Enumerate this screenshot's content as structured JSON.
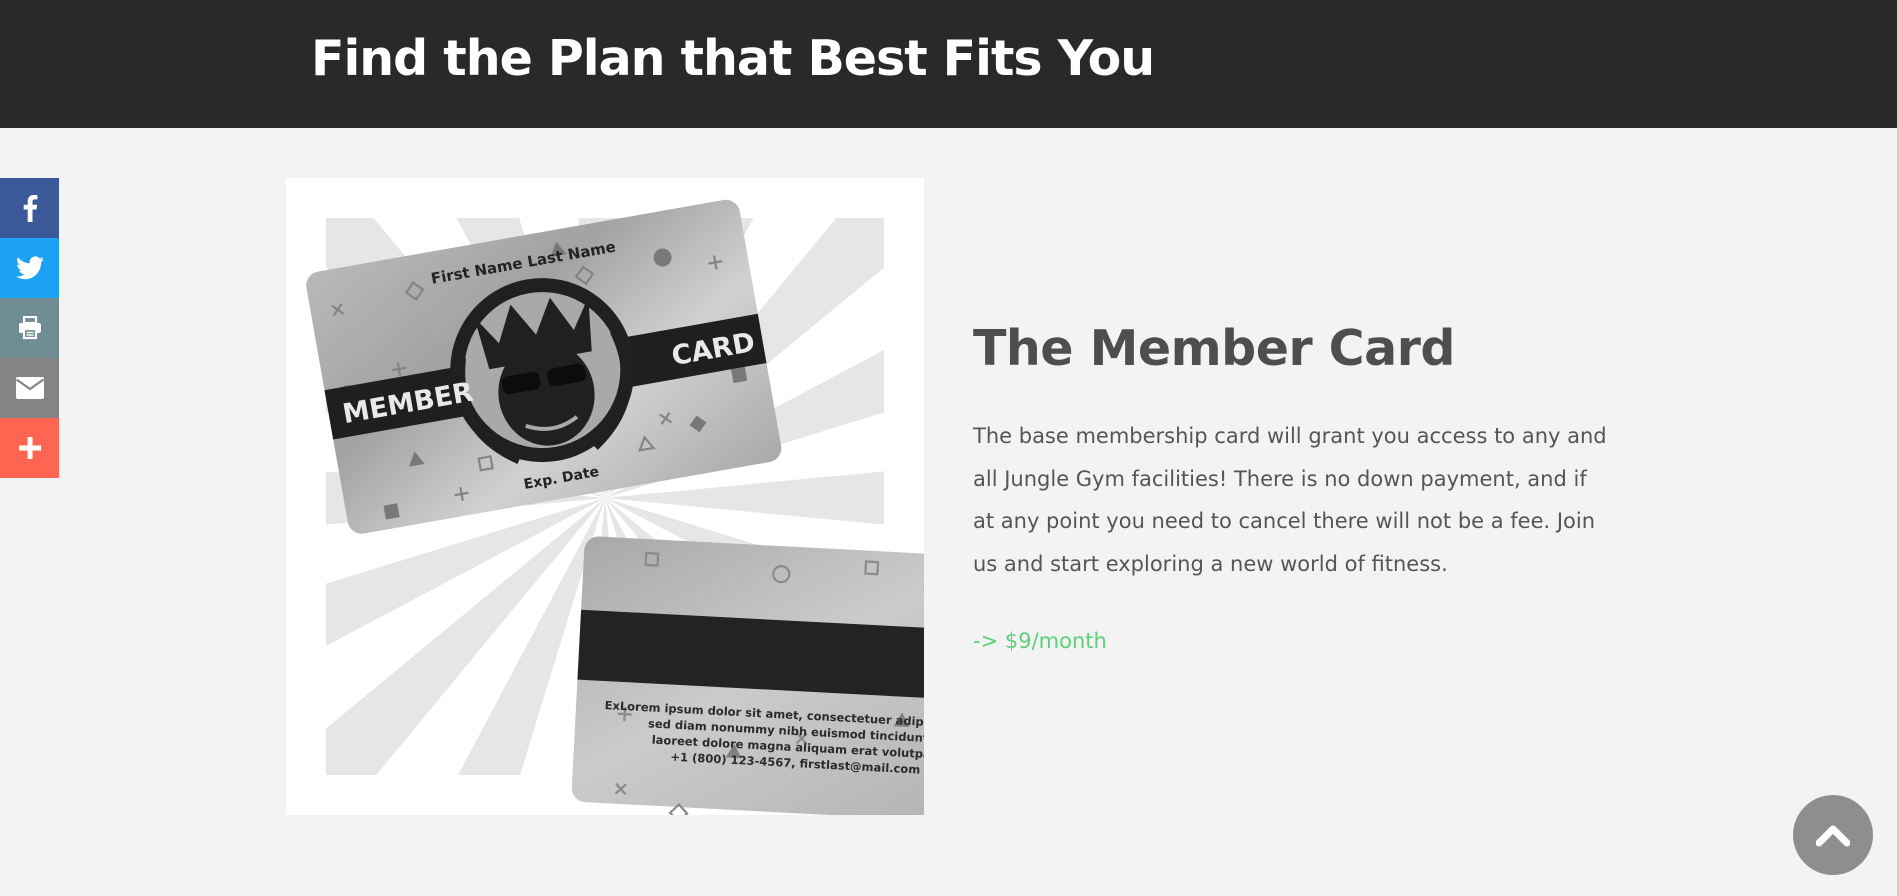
{
  "header": {
    "title": "Find the Plan that Best Fits You"
  },
  "share_bar": {
    "items": [
      {
        "name": "facebook",
        "icon": "facebook-icon",
        "color": "#3b5998"
      },
      {
        "name": "twitter",
        "icon": "twitter-icon",
        "color": "#1da1f2"
      },
      {
        "name": "print",
        "icon": "print-icon",
        "color": "#6f8d93"
      },
      {
        "name": "email",
        "icon": "email-icon",
        "color": "#848484"
      },
      {
        "name": "more",
        "icon": "plus-icon",
        "color": "#ff6550"
      }
    ]
  },
  "card_image": {
    "front_name": "First Name Last Name",
    "front_left": "MEMBER",
    "front_right": "CARD",
    "front_expiry": "Exp. Date",
    "back_lines": [
      "ExLorem ipsum dolor sit amet, consectetuer adipiscing elit,",
      "sed diam nonummy nibh euismod tincidunt ut",
      "laoreet dolore magna aliquam erat volutpat.",
      "+1 (800) 123-4567, firstlast@mail.com"
    ]
  },
  "plan": {
    "title": "The Member Card",
    "description": "The base membership card will grant you access to any and all Jungle Gym facilities! There is no down payment, and if at any point you need to cancel there will not be a fee. Join us and start exploring a new world of fitness.",
    "price": "-> $9/month",
    "price_color": "#5bd17a"
  },
  "back_to_top": {
    "icon": "chevron-up-icon"
  }
}
